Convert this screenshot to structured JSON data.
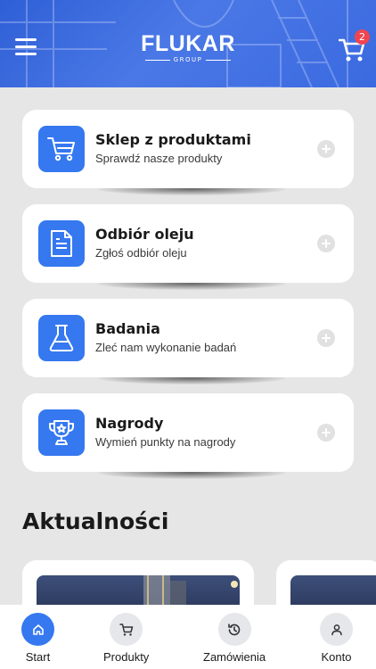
{
  "header": {
    "logo_title": "FLUKAR",
    "logo_subtitle": "GROUP",
    "menu_icon": "hamburger-icon",
    "cart_icon": "cart-icon",
    "cart_badge": "2",
    "colors": {
      "header": "#3b6ae0",
      "badge": "#f0454f"
    }
  },
  "cards": [
    {
      "title": "Sklep z produktami",
      "subtitle": "Sprawdź nasze produkty",
      "icon": "shopping-cart-icon"
    },
    {
      "title": "Odbiór oleju",
      "subtitle": "Zgłoś odbiór oleju",
      "icon": "document-icon"
    },
    {
      "title": "Badania",
      "subtitle": "Zleć nam wykonanie badań",
      "icon": "flask-icon"
    },
    {
      "title": "Nagrody",
      "subtitle": "Wymień punkty na nagrody",
      "icon": "trophy-icon"
    }
  ],
  "news": {
    "title": "Aktualności"
  },
  "tabs": [
    {
      "label": "Start",
      "icon": "home-icon",
      "active": true
    },
    {
      "label": "Produkty",
      "icon": "cart-icon",
      "active": false
    },
    {
      "label": "Zamówienia",
      "icon": "history-icon",
      "active": false
    },
    {
      "label": "Konto",
      "icon": "user-icon",
      "active": false
    }
  ],
  "colors": {
    "accent": "#3578f0",
    "background": "#e6e6e6",
    "card": "#ffffff"
  }
}
